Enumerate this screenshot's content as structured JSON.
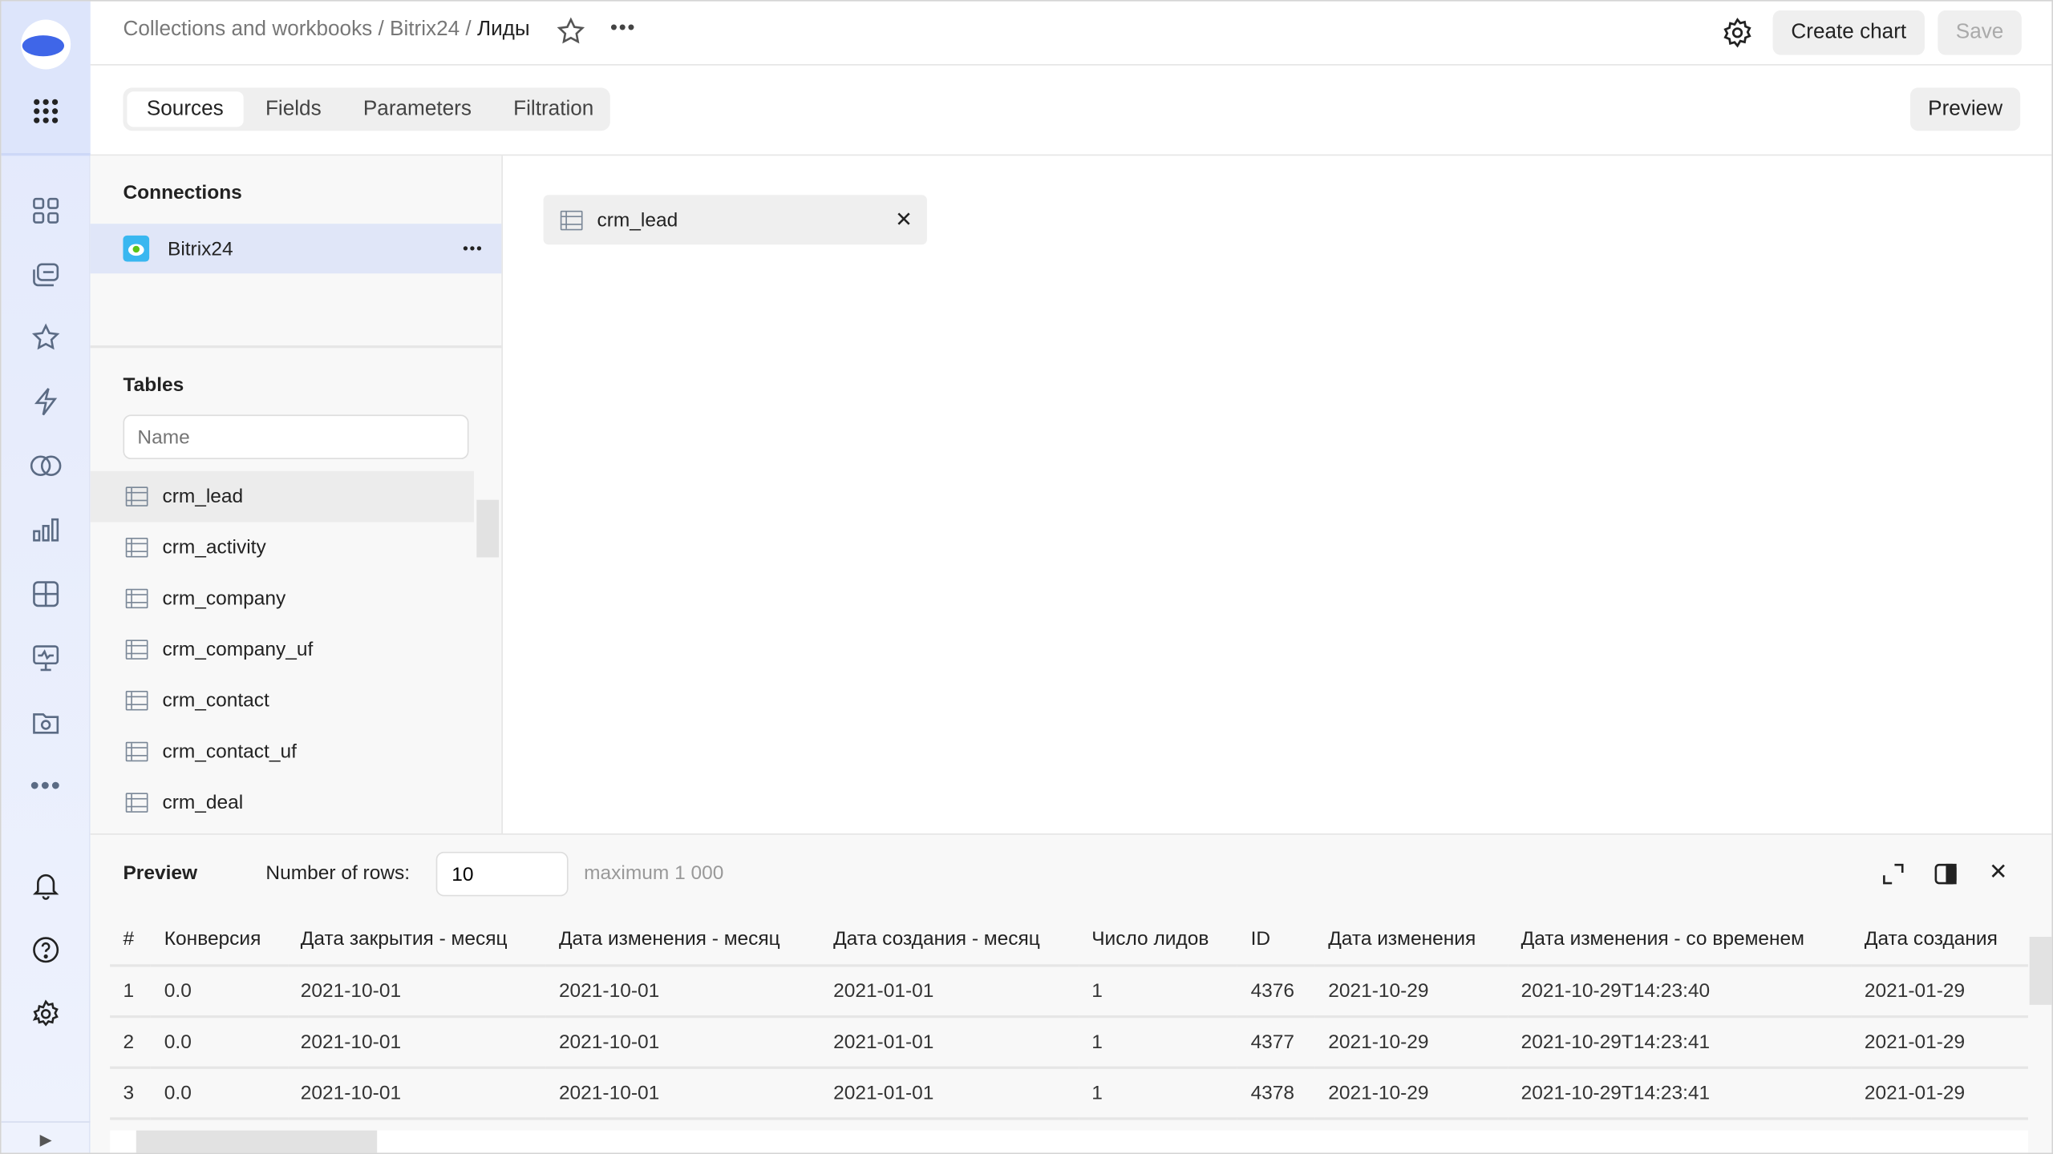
{
  "header": {
    "breadcrumb": [
      "Collections and workbooks",
      "Bitrix24",
      "Лиды"
    ],
    "separator": "/",
    "create_chart": "Create chart",
    "save": "Save"
  },
  "tabs": [
    "Sources",
    "Fields",
    "Parameters",
    "Filtration"
  ],
  "preview_button": "Preview",
  "connections": {
    "title": "Connections",
    "items": [
      "Bitrix24"
    ]
  },
  "tables": {
    "title": "Tables",
    "search_placeholder": "Name",
    "items": [
      "crm_lead",
      "crm_activity",
      "crm_company",
      "crm_company_uf",
      "crm_contact",
      "crm_contact_uf",
      "crm_deal"
    ]
  },
  "selected_source": "crm_lead",
  "preview": {
    "title": "Preview",
    "rows_label": "Number of rows:",
    "rows_value": "10",
    "rows_hint": "maximum 1 000",
    "columns": [
      "#",
      "Конверсия",
      "Дата закрытия - месяц",
      "Дата изменения - месяц",
      "Дата создания - месяц",
      "Число лидов",
      "ID",
      "Дата изменения",
      "Дата изменения - со временем",
      "Дата создания"
    ],
    "rows": [
      [
        "1",
        "0.0",
        "2021-10-01",
        "2021-10-01",
        "2021-01-01",
        "1",
        "4376",
        "2021-10-29",
        "2021-10-29T14:23:40",
        "2021-01-29"
      ],
      [
        "2",
        "0.0",
        "2021-10-01",
        "2021-10-01",
        "2021-01-01",
        "1",
        "4377",
        "2021-10-29",
        "2021-10-29T14:23:41",
        "2021-01-29"
      ],
      [
        "3",
        "0.0",
        "2021-10-01",
        "2021-10-01",
        "2021-01-01",
        "1",
        "4378",
        "2021-10-29",
        "2021-10-29T14:23:41",
        "2021-01-29"
      ]
    ]
  },
  "colors": {
    "accent": "#3f66e8",
    "selected_row": "#e0e6f8"
  }
}
